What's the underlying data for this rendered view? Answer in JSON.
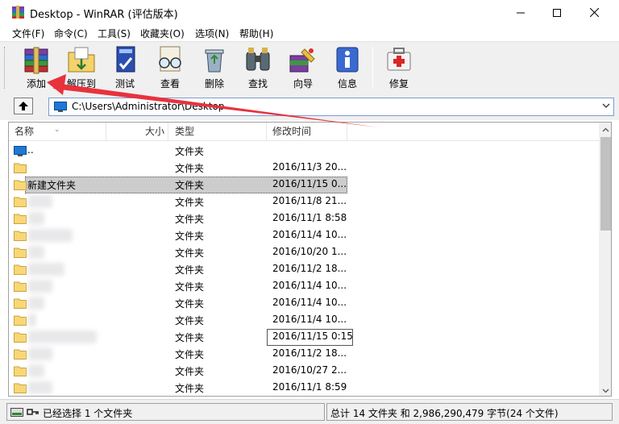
{
  "window": {
    "title": "Desktop - WinRAR (评估版本)"
  },
  "menu": [
    "文件(F)",
    "命令(C)",
    "工具(S)",
    "收藏夹(O)",
    "选项(N)",
    "帮助(H)"
  ],
  "toolbar": {
    "add": "添加",
    "extract": "解压到",
    "test": "测试",
    "view": "查看",
    "delete": "删除",
    "find": "查找",
    "wizard": "向导",
    "info": "信息",
    "repair": "修复"
  },
  "address": {
    "path": "C:\\Users\\Administrator\\Desktop"
  },
  "columns": {
    "name": "名称",
    "size": "大小",
    "type": "类型",
    "modified": "修改时间"
  },
  "rows": [
    {
      "name": "..",
      "type": "文件夹",
      "modified": ""
    },
    {
      "name": "",
      "type": "文件夹",
      "modified": "2016/11/3 20..."
    },
    {
      "name": "新建文件夹",
      "type": "文件夹",
      "modified": "2016/11/15 0..."
    },
    {
      "name": "",
      "type": "文件夹",
      "modified": "2016/11/8 21..."
    },
    {
      "name": "",
      "type": "文件夹",
      "modified": "2016/11/1 8:58"
    },
    {
      "name": "",
      "type": "文件夹",
      "modified": "2016/11/4 10..."
    },
    {
      "name": "",
      "type": "文件夹",
      "modified": "2016/10/20 1..."
    },
    {
      "name": "",
      "type": "文件夹",
      "modified": "2016/11/2 18..."
    },
    {
      "name": "",
      "type": "文件夹",
      "modified": "2016/11/4 10..."
    },
    {
      "name": "",
      "type": "文件夹",
      "modified": "2016/11/4 10..."
    },
    {
      "name": "",
      "type": "文件夹",
      "modified": "2016/11/4 10..."
    },
    {
      "name": "",
      "type": "文件夹",
      "modified": "2016/11/15 0:15"
    },
    {
      "name": "",
      "type": "文件夹",
      "modified": "2016/11/2 18..."
    },
    {
      "name": "",
      "type": "文件夹",
      "modified": "2016/10/27 2..."
    },
    {
      "name": "",
      "type": "文件夹",
      "modified": "2016/11/1 8:59"
    }
  ],
  "status": {
    "left": "已经选择 1 个文件夹",
    "right": "总计 14 文件夹 和 2,986,290,479 字节(24 个文件)"
  },
  "colors": {
    "annotation_arrow": "#e8323c",
    "selection": "#cccccc",
    "folder": "#f8d775"
  }
}
